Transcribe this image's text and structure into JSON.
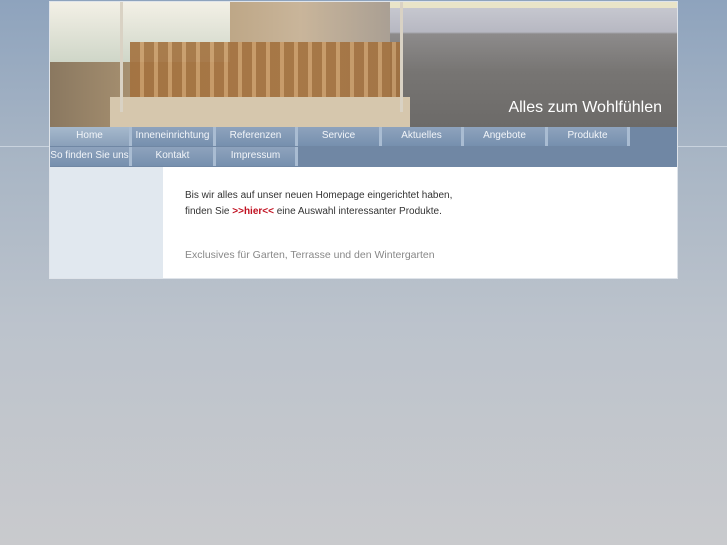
{
  "header": {
    "tagline": "Alles zum Wohlfühlen"
  },
  "nav": {
    "row1": [
      "Home",
      "Inneneinrichtung",
      "Referenzen",
      "Service",
      "Aktuelles",
      "Angebote",
      "Produkte"
    ],
    "row2": [
      "So finden Sie uns",
      "Kontakt",
      "Impressum"
    ]
  },
  "content": {
    "line1": "Bis wir alles auf unser neuen Homepage eingerichtet haben,",
    "line2_pre": "finden Sie",
    "link": ">>hier<<",
    "line2_post": "eine Auswahl interessanter Produkte.",
    "subtitle": "Exclusives für Garten, Terrasse und den Wintergarten"
  },
  "colors": {
    "link": "#c01020",
    "nav": "#7690ae"
  }
}
